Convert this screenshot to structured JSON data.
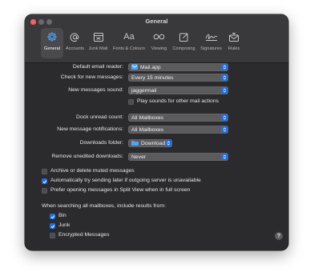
{
  "window": {
    "title": "General"
  },
  "tabs": [
    {
      "label": "General",
      "icon": "gear-icon"
    },
    {
      "label": "Accounts",
      "icon": "at-icon"
    },
    {
      "label": "Junk Mail",
      "icon": "junk-tray-icon"
    },
    {
      "label": "Fonts & Colours",
      "icon": "font-icon"
    },
    {
      "label": "Viewing",
      "icon": "glasses-icon"
    },
    {
      "label": "Composing",
      "icon": "compose-icon"
    },
    {
      "label": "Signatures",
      "icon": "signature-icon"
    },
    {
      "label": "Rules",
      "icon": "rules-envelope-icon"
    }
  ],
  "settings": {
    "default_reader": {
      "label": "Default email reader:",
      "value": "Mail.app"
    },
    "check_messages": {
      "label": "Check for new messages:",
      "value": "Every 15 minutes"
    },
    "new_sound": {
      "label": "New messages sound:",
      "value": "jaggermail"
    },
    "play_sounds": {
      "label": "Play sounds for other mail actions",
      "checked": false
    },
    "dock_unread": {
      "label": "Dock unread count:",
      "value": "All Mailboxes"
    },
    "notifications": {
      "label": "New message notifications:",
      "value": "All Mailboxes"
    },
    "downloads_folder": {
      "label": "Downloads folder:",
      "value": "Downloads"
    },
    "remove_downloads": {
      "label": "Remove unedited downloads:",
      "value": "Never"
    },
    "archive_muted": {
      "label": "Archive or delete muted messages",
      "checked": false
    },
    "auto_retry": {
      "label": "Automatically try sending later if outgoing server is unavailable",
      "checked": true
    },
    "split_view": {
      "label": "Prefer opening messages in Split View when in full screen",
      "checked": false
    }
  },
  "search": {
    "heading": "When searching all mailboxes, include results from:",
    "bin": {
      "label": "Bin",
      "checked": true
    },
    "junk": {
      "label": "Junk",
      "checked": true
    },
    "encrypted": {
      "label": "Encrypted Messages",
      "checked": false
    }
  },
  "help": {
    "label": "?"
  },
  "colors": {
    "accent": "#1f6fe5",
    "window_bg": "#2b2b2d",
    "close": "#fe5f57"
  }
}
